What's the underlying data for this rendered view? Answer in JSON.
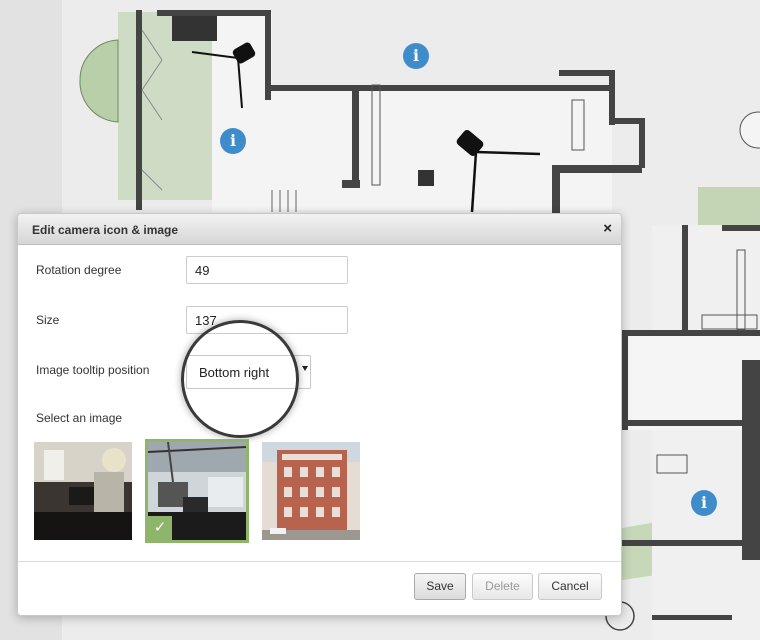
{
  "dialog": {
    "title": "Edit camera icon & image",
    "close_glyph": "×",
    "rotation": {
      "label": "Rotation degree",
      "value": "49"
    },
    "size": {
      "label": "Size",
      "value": "137"
    },
    "tooltip_position": {
      "label": "Image tooltip position",
      "selected": "Bottom right"
    },
    "select_image": {
      "label": "Select an image"
    },
    "images": [
      {
        "name": "interior-dining",
        "selected": false
      },
      {
        "name": "interior-atrium",
        "selected": true
      },
      {
        "name": "building-exterior",
        "selected": false
      }
    ],
    "buttons": {
      "save": "Save",
      "delete": "Delete",
      "cancel": "Cancel"
    }
  },
  "floorplan": {
    "info_glyph": "i",
    "info_count": 3
  },
  "colors": {
    "accent_info": "#3f8ccb",
    "selected_green": "#8fb56b"
  }
}
